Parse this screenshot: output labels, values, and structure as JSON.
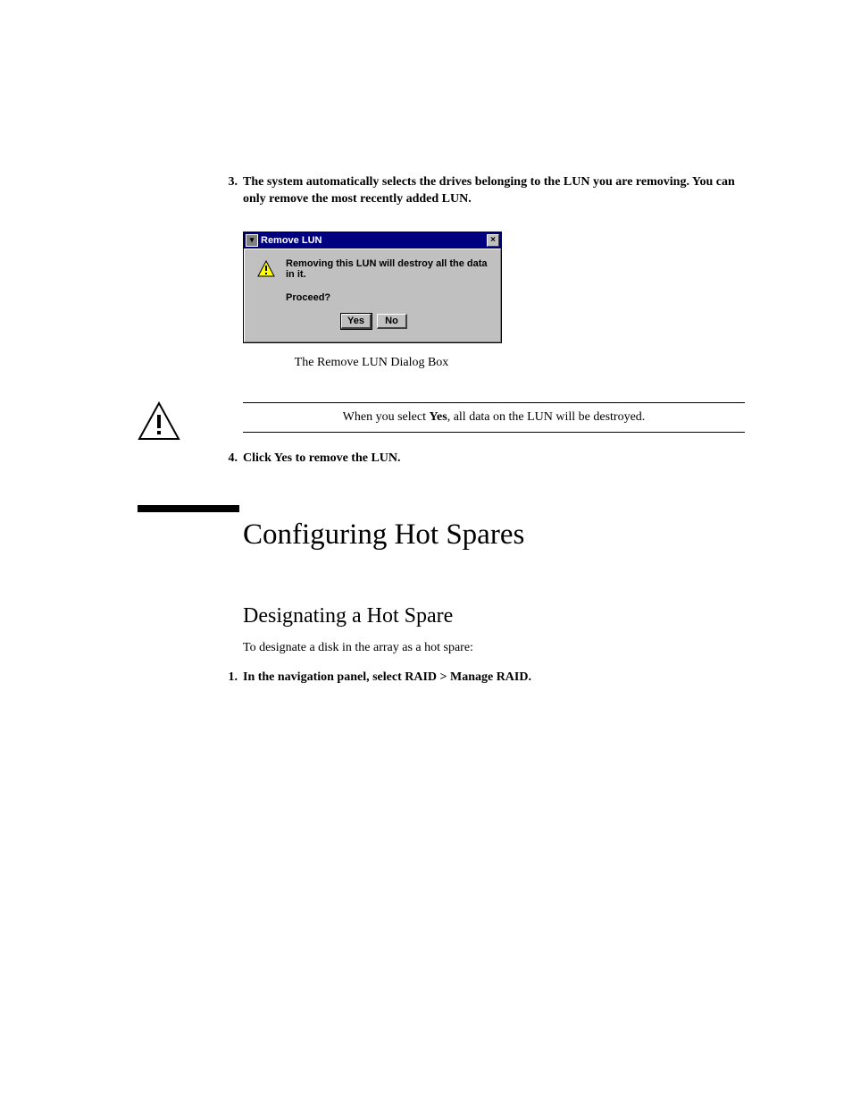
{
  "step3": {
    "number": "3.",
    "text": "The system automatically selects the drives belonging to the LUN you are removing. You can only remove the most recently added LUN."
  },
  "dialog": {
    "title": "Remove LUN",
    "message": "Removing this LUN will destroy all the data in it.",
    "prompt": "Proceed?",
    "yes": "Yes",
    "no": "No",
    "caption": "The Remove LUN Dialog Box"
  },
  "caution": {
    "prefix": "When you select ",
    "bold": "Yes",
    "suffix": ", all data on the LUN will be destroyed."
  },
  "step4": {
    "number": "4.",
    "text": "Click Yes to remove the LUN."
  },
  "heading1": "Configuring Hot Spares",
  "heading2": "Designating a Hot Spare",
  "intro": "To designate a disk in the array as a hot spare:",
  "step1": {
    "number": "1.",
    "text": "In the navigation panel, select RAID > Manage RAID."
  }
}
